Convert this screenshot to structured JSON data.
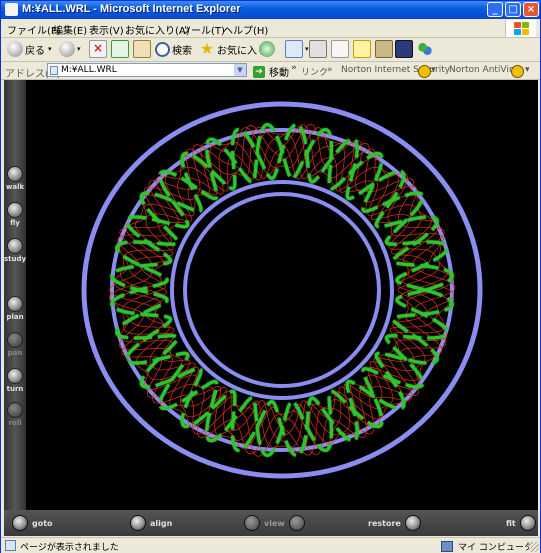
{
  "window": {
    "title": "M:¥ALL.WRL - Microsoft Internet Explorer",
    "controls": {
      "minimize": "_",
      "maximize": "□",
      "close": "×"
    }
  },
  "menu": {
    "items": [
      "ファイル(F)",
      "編集(E)",
      "表示(V)",
      "お気に入り(A)",
      "ツール(T)",
      "ヘルプ(H)"
    ]
  },
  "toolbar": {
    "back": "戻る",
    "search": "検索",
    "favorites": "お気に入り"
  },
  "address": {
    "label": "アドレス(D)",
    "value": "M:¥ALL.WRL",
    "go": "移動",
    "chevron": "»",
    "links": "リンク",
    "norton_security": "Norton Internet Security",
    "norton_antivirus": "Norton AntiVirus"
  },
  "viewer": {
    "left_nav": [
      "walk",
      "fly",
      "study",
      "plan",
      "pan",
      "turn",
      "roll"
    ],
    "bottom": {
      "goto": "goto",
      "align": "align",
      "view": "view",
      "restore": "restore",
      "fit": "fit"
    }
  },
  "status": {
    "text": "ページが表示されました",
    "zone": "マイ コンピュータ"
  },
  "colors": {
    "titlebar": "#0a5ce0",
    "scene_bg": "#000000",
    "ring": "#8a8ef0",
    "helix": "#2ec42e",
    "fieldlines": "#e0301a"
  }
}
